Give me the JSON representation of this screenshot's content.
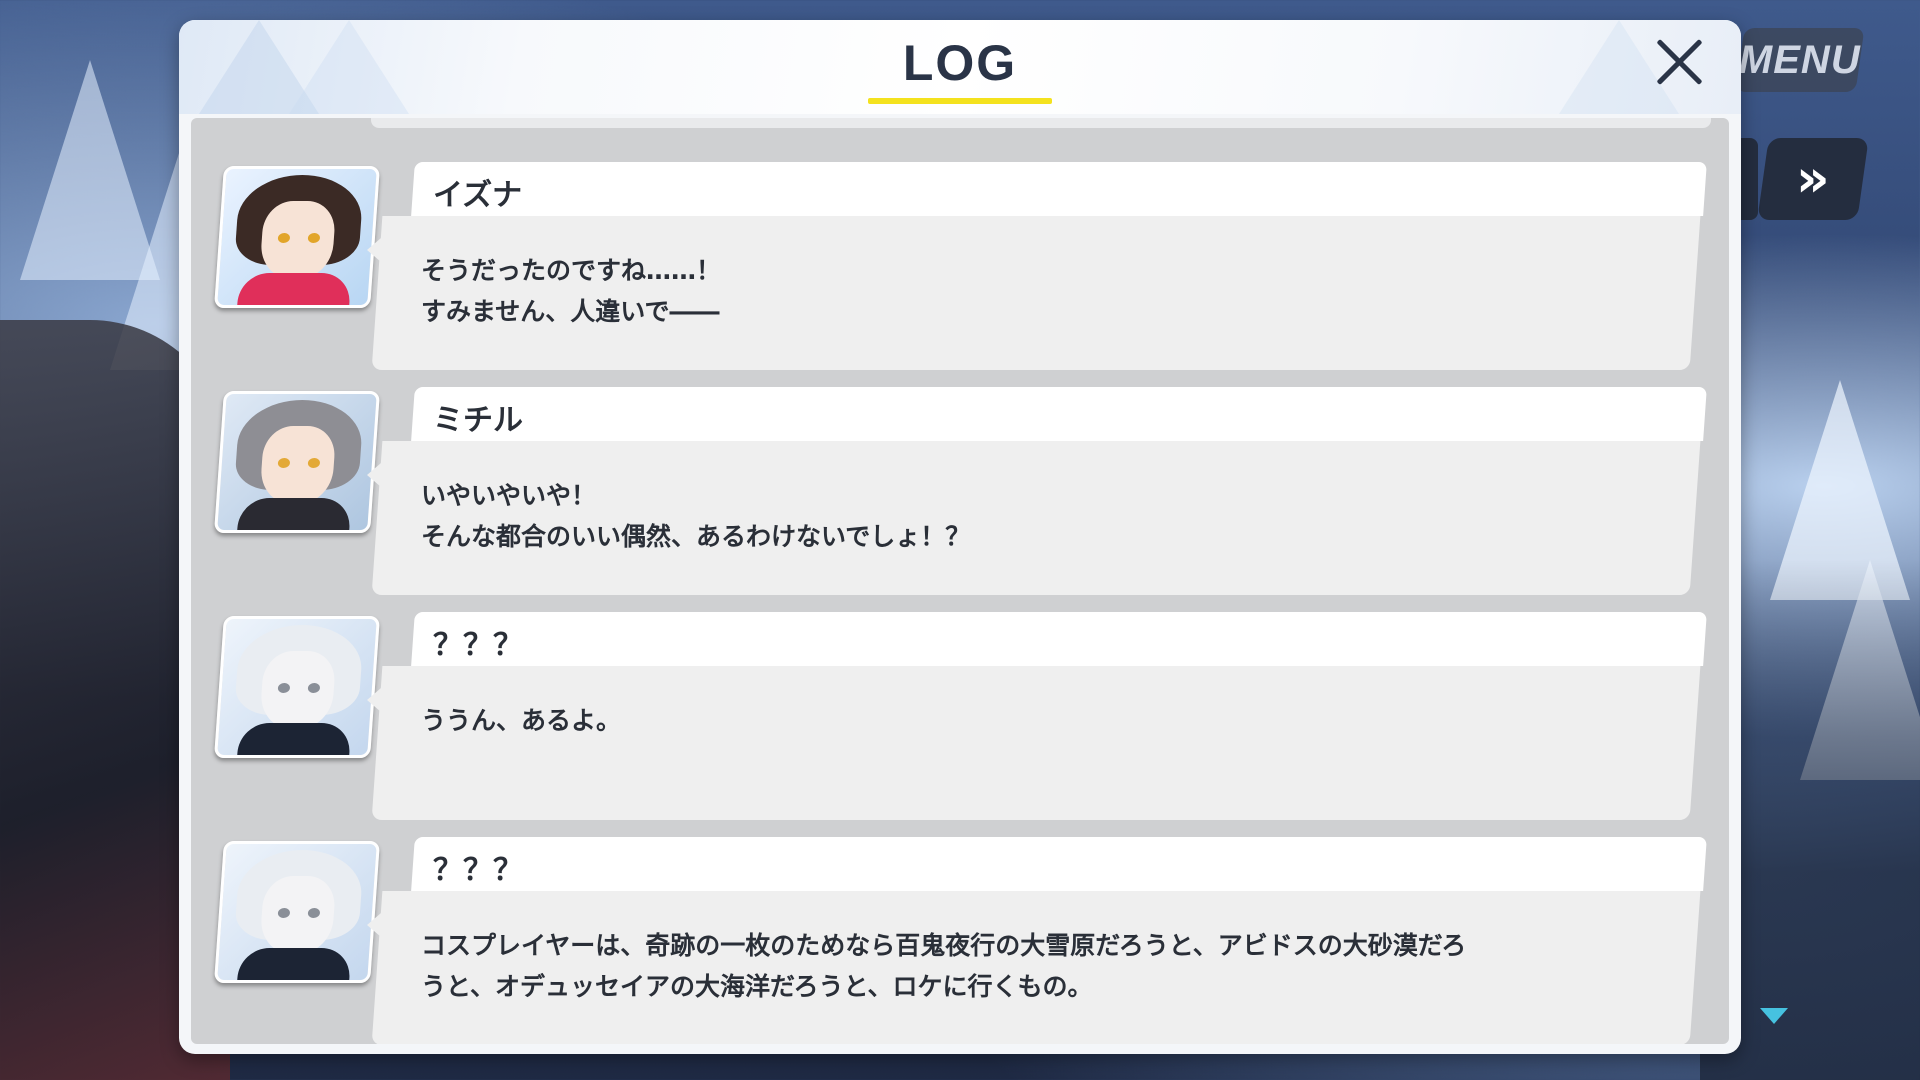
{
  "header": {
    "title": "LOG"
  },
  "controls": {
    "menu_label": "MENU",
    "fast_forward_label": "»"
  },
  "entries": [
    {
      "speaker": "イズナ",
      "text": "そうだったのですね……！\nすみません、人違いで――"
    },
    {
      "speaker": "ミチル",
      "text": "いやいやいや！\nそんな都合のいい偶然、あるわけないでしょ！？"
    },
    {
      "speaker": "？？？",
      "text": "ううん、あるよ。"
    },
    {
      "speaker": "？？？",
      "text": "コスプレイヤーは、奇跡の一枚のためなら百鬼夜行の大雪原だろうと、アビドスの大砂漠だろ\nうと、オデュッセイアの大海洋だろうと、ロケに行くもの。"
    }
  ],
  "colors": {
    "title_underline": "#f4e21e",
    "scroll_indicator": "#46c2e0"
  }
}
